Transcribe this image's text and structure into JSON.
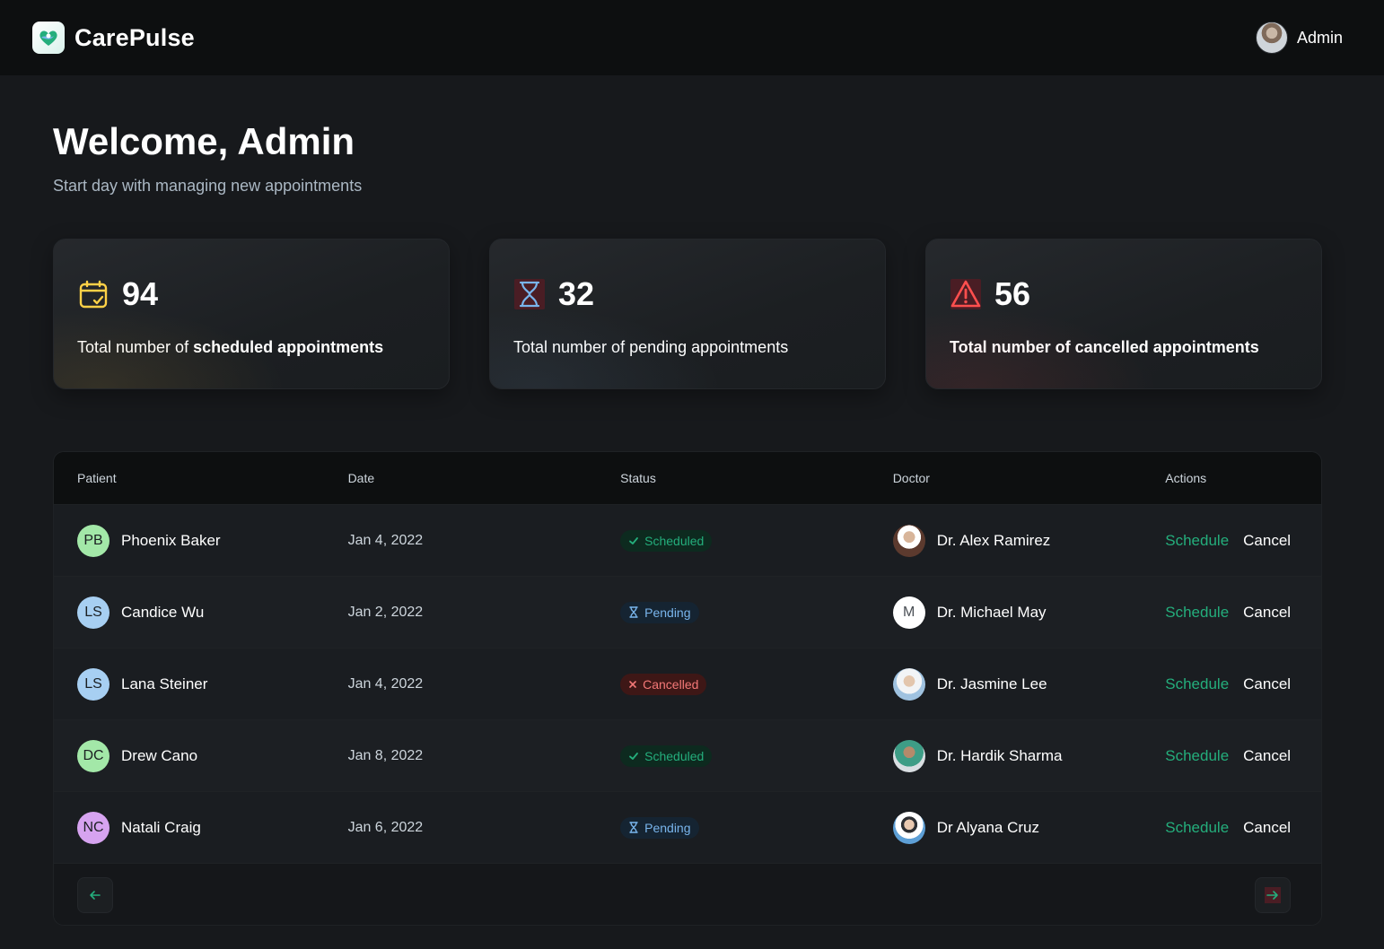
{
  "header": {
    "brand": "CarePulse",
    "user_label": "Admin"
  },
  "welcome": {
    "title": "Welcome, Admin",
    "subtitle": "Start day with managing new appointments"
  },
  "stats": [
    {
      "count": "94",
      "label_prefix": "Total number of ",
      "label_strong": "scheduled appointments",
      "icon": "calendar-check-icon",
      "color": "#ffd147"
    },
    {
      "count": "32",
      "label_prefix": "Total number of pending appointments",
      "label_strong": "",
      "icon": "hourglass-icon",
      "color": "#79b5ec"
    },
    {
      "count": "56",
      "label_prefix": "Total number of cancelled ",
      "label_strong": "appointments",
      "icon": "alert-triangle-icon",
      "color": "#ff4f4e"
    }
  ],
  "table": {
    "headers": [
      "Patient",
      "Date",
      "Status",
      "Doctor",
      "Actions"
    ],
    "rows": [
      {
        "initials": "PB",
        "initials_bg": "#a3e8a8",
        "patient": "Phoenix Baker",
        "date": "Jan 4, 2022",
        "status": "Scheduled",
        "status_type": "scheduled",
        "doctor": "Dr. Alex Ramirez",
        "doctor_avatar": "doctor-photo-1",
        "schedule": "Schedule",
        "cancel": "Cancel"
      },
      {
        "initials": "LS",
        "initials_bg": "#a7cff2",
        "patient": "Candice Wu",
        "date": "Jan 2, 2022",
        "status": "Pending",
        "status_type": "pending",
        "doctor": "Dr. Michael May",
        "doctor_avatar": "M",
        "schedule": "Schedule",
        "cancel": "Cancel"
      },
      {
        "initials": "LS",
        "initials_bg": "#a7cff2",
        "patient": "Lana Steiner",
        "date": "Jan 4, 2022",
        "status": "Cancelled",
        "status_type": "cancelled",
        "doctor": "Dr. Jasmine Lee",
        "doctor_avatar": "doctor-photo-3",
        "schedule": "Schedule",
        "cancel": "Cancel"
      },
      {
        "initials": "DC",
        "initials_bg": "#a3e8a8",
        "patient": "Drew Cano",
        "date": "Jan 8, 2022",
        "status": "Scheduled",
        "status_type": "scheduled",
        "doctor": "Dr. Hardik Sharma",
        "doctor_avatar": "doctor-photo-4",
        "schedule": "Schedule",
        "cancel": "Cancel"
      },
      {
        "initials": "NC",
        "initials_bg": "#d6a3f0",
        "patient": "Natali Craig",
        "date": "Jan 6, 2022",
        "status": "Pending",
        "status_type": "pending",
        "doctor": "Dr Alyana Cruz",
        "doctor_avatar": "doctor-photo-5",
        "schedule": "Schedule",
        "cancel": "Cancel"
      }
    ]
  },
  "pagination": {
    "prev_icon": "arrow-left-icon",
    "next_icon": "arrow-right-icon"
  },
  "colors": {
    "accent_green": "#24ae7c",
    "pending_blue": "#79b5ec",
    "cancel_red": "#f37877",
    "background": "#17191c"
  }
}
